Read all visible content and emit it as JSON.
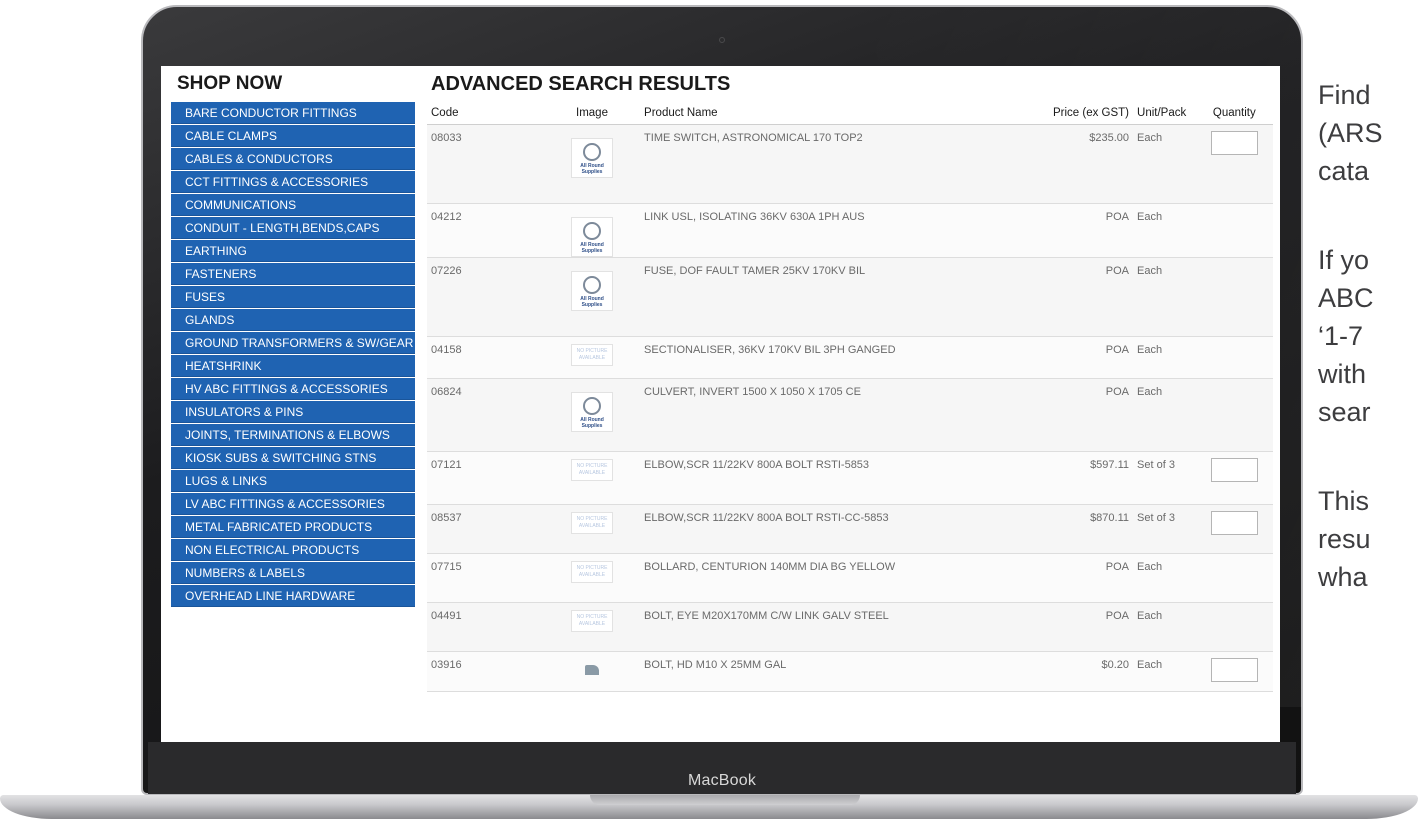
{
  "laptop": {
    "brand": "MacBook"
  },
  "sidebar": {
    "title": "SHOP NOW",
    "items": [
      "BARE CONDUCTOR FITTINGS",
      "CABLE CLAMPS",
      "CABLES & CONDUCTORS",
      "CCT FITTINGS & ACCESSORIES",
      "COMMUNICATIONS",
      "CONDUIT - LENGTH,BENDS,CAPS",
      "EARTHING",
      "FASTENERS",
      "FUSES",
      "GLANDS",
      "GROUND TRANSFORMERS & SW/GEAR",
      "HEATSHRINK",
      "HV ABC FITTINGS & ACCESSORIES",
      "INSULATORS & PINS",
      "JOINTS, TERMINATIONS & ELBOWS",
      "KIOSK SUBS & SWITCHING STNS",
      "LUGS & LINKS",
      "LV ABC FITTINGS & ACCESSORIES",
      "METAL FABRICATED PRODUCTS",
      "NON ELECTRICAL PRODUCTS",
      "NUMBERS & LABELS",
      "OVERHEAD LINE HARDWARE"
    ]
  },
  "main": {
    "title": "ADVANCED SEARCH RESULTS",
    "columns": [
      "Code",
      "Image",
      "Product Name",
      "Price (ex GST)",
      "Unit/Pack",
      "Quantity"
    ],
    "image_text": {
      "logo_line1": "All Round",
      "logo_line2": "Supplies",
      "no_picture": "NO PICTURE AVAILABLE"
    },
    "rows": [
      {
        "code": "08033",
        "image": "logo",
        "name": "TIME SWITCH, ASTRONOMICAL 170 TOP2",
        "price": "$235.00",
        "unit": "Each",
        "qty": true
      },
      {
        "code": "04212",
        "image": "logo",
        "name": "LINK USL, ISOLATING 36KV 630A 1PH AUS",
        "price": "POA",
        "unit": "Each",
        "qty": false
      },
      {
        "code": "07226",
        "image": "logo",
        "name": "FUSE, DOF FAULT TAMER 25KV 170KV BIL",
        "price": "POA",
        "unit": "Each",
        "qty": false
      },
      {
        "code": "04158",
        "image": "none",
        "name": "SECTIONALISER, 36KV 170KV BIL 3PH GANGED",
        "price": "POA",
        "unit": "Each",
        "qty": false
      },
      {
        "code": "06824",
        "image": "logo",
        "name": "CULVERT, INVERT 1500 X 1050 X 1705 CE",
        "price": "POA",
        "unit": "Each",
        "qty": false
      },
      {
        "code": "07121",
        "image": "none",
        "name": "ELBOW,SCR 11/22KV 800A BOLT RSTI-5853",
        "price": "$597.11",
        "unit": "Set of 3",
        "qty": true
      },
      {
        "code": "08537",
        "image": "none",
        "name": "ELBOW,SCR 11/22KV 800A BOLT RSTI-CC-5853",
        "price": "$870.11",
        "unit": "Set of 3",
        "qty": true
      },
      {
        "code": "07715",
        "image": "none",
        "name": "BOLLARD, CENTURION 140MM DIA BG YELLOW",
        "price": "POA",
        "unit": "Each",
        "qty": false
      },
      {
        "code": "04491",
        "image": "none",
        "name": "BOLT, EYE M20X170MM C/W LINK GALV STEEL",
        "price": "POA",
        "unit": "Each",
        "qty": false
      },
      {
        "code": "03916",
        "image": "bolt",
        "name": "BOLT, HD M10 X 25MM GAL",
        "price": "$0.20",
        "unit": "Each",
        "qty": true
      }
    ]
  },
  "side_text": {
    "lines": [
      "Find",
      "(ARS",
      "cata",
      "",
      "If yo",
      "ABC",
      "‘1-7",
      "with",
      "sear",
      "",
      "This",
      "resu",
      "wha"
    ]
  },
  "colors": {
    "category_blue": "#1f63b2",
    "row_alt": "#f6f6f6"
  }
}
